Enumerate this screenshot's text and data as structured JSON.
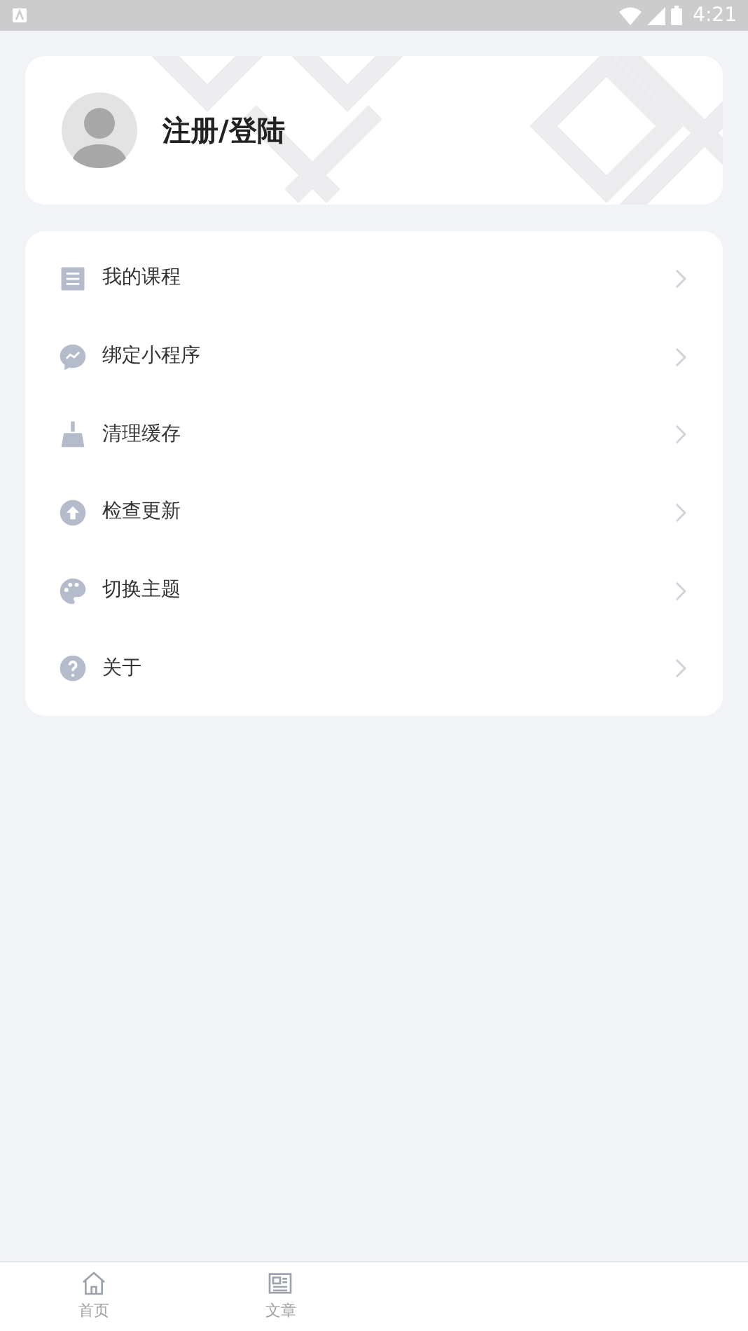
{
  "status_bar": {
    "time": "4:21"
  },
  "profile": {
    "title": "注册/登陆"
  },
  "menu": [
    {
      "label": "我的课程",
      "kind": "list"
    },
    {
      "label": "绑定小程序",
      "kind": "chat"
    },
    {
      "label": "清理缓存",
      "kind": "broom"
    },
    {
      "label": "检查更新",
      "kind": "upload"
    },
    {
      "label": "切换主题",
      "kind": "palette"
    },
    {
      "label": "关于",
      "kind": "help"
    }
  ],
  "tab_bar": [
    {
      "label": "首页",
      "kind": "home",
      "selected": false
    },
    {
      "label": "文章",
      "kind": "article",
      "selected": false
    }
  ]
}
